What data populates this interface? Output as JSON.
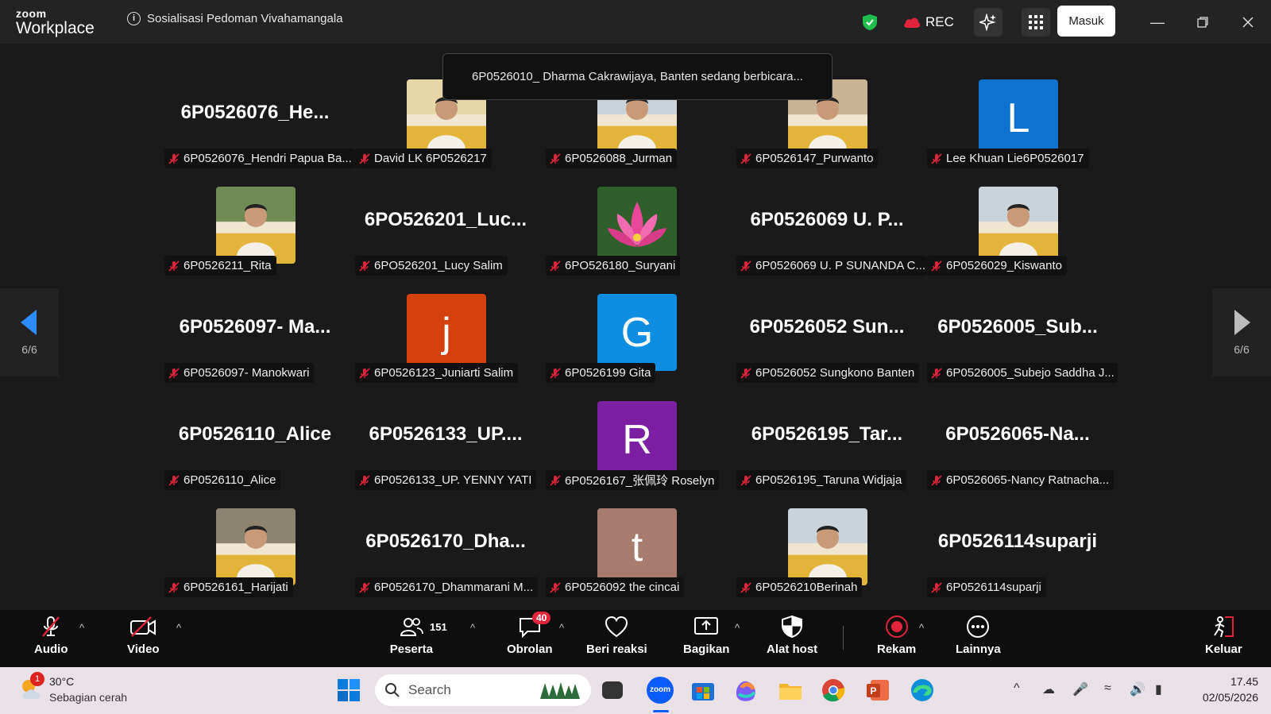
{
  "app": {
    "brand_small": "zoom",
    "brand_large": "Workplace",
    "meeting_title": "Sosialisasi Pedoman Vivahamangala"
  },
  "titlebar": {
    "rec_label": "REC",
    "signin_label": "Masuk"
  },
  "banner": "6P0526010_ Dharma Cakrawijaya, Banten sedang berbicara...",
  "pager": {
    "left_count": "6/6",
    "right_count": "6/6"
  },
  "tiles": [
    {
      "name": "6P0526076_Hendri Papua Ba...",
      "big": "6P0526076_He...",
      "avatar": ""
    },
    {
      "name": "David LK 6P0526217",
      "big": "",
      "avatar": "photo"
    },
    {
      "name": "6P0526088_Jurman",
      "big": "",
      "avatar": "photo"
    },
    {
      "name": "6P0526147_Purwanto",
      "big": "",
      "avatar": "photo"
    },
    {
      "name": "Lee Khuan Lie6P0526017",
      "big": "",
      "avatar": "L"
    },
    {
      "name": "6P0526211_Rita",
      "big": "",
      "avatar": "photo"
    },
    {
      "name": "6PO526201_Lucy Salim",
      "big": "6PO526201_Luc...",
      "avatar": ""
    },
    {
      "name": "6PO526180_Suryani",
      "big": "",
      "avatar": "lotus"
    },
    {
      "name": "6P0526069 U. P SUNANDA C...",
      "big": "6P0526069 U. P...",
      "avatar": ""
    },
    {
      "name": "6P0526029_Kiswanto",
      "big": "",
      "avatar": "photo"
    },
    {
      "name": "6P0526097- Manokwari",
      "big": "6P0526097- Ma...",
      "avatar": ""
    },
    {
      "name": "6P0526123_Juniarti Salim",
      "big": "",
      "avatar": "j"
    },
    {
      "name": "6P0526199 Gita",
      "big": "",
      "avatar": "G"
    },
    {
      "name": "6P0526052 Sungkono Banten",
      "big": "6P0526052 Sun...",
      "avatar": ""
    },
    {
      "name": "6P0526005_Subejo Saddha J...",
      "big": "6P0526005_Sub...",
      "avatar": ""
    },
    {
      "name": "6P0526110_Alice",
      "big": "6P0526110_Alice",
      "avatar": ""
    },
    {
      "name": "6P0526133_UP. YENNY YATI",
      "big": "6P0526133_UP....",
      "avatar": ""
    },
    {
      "name": "6P0526167_张佩玲 Roselyn",
      "big": "",
      "avatar": "R"
    },
    {
      "name": "6P0526195_Taruna Widjaja",
      "big": "6P0526195_Tar...",
      "avatar": ""
    },
    {
      "name": "6P0526065-Nancy Ratnacha...",
      "big": "6P0526065-Na...",
      "avatar": ""
    },
    {
      "name": "6P0526161_Harijati",
      "big": "",
      "avatar": "photo"
    },
    {
      "name": "6P0526170_Dhammarani M...",
      "big": "6P0526170_Dha...",
      "avatar": ""
    },
    {
      "name": "6P0526092 the cincai",
      "big": "",
      "avatar": "t"
    },
    {
      "name": "6P0526210Berinah",
      "big": "",
      "avatar": "photo"
    },
    {
      "name": "6P0526114suparji",
      "big": "6P0526114suparji",
      "avatar": ""
    }
  ],
  "toolbar": {
    "audio": "Audio",
    "video": "Video",
    "participants": "Peserta",
    "participant_count": "151",
    "chat": "Obrolan",
    "chat_badge": "40",
    "react": "Beri reaksi",
    "share": "Bagikan",
    "host_tools": "Alat host",
    "record": "Rekam",
    "more": "Lainnya",
    "leave": "Keluar"
  },
  "taskbar": {
    "weather_temp": "30°C",
    "weather_desc": "Sebagian cerah",
    "weather_badge": "1",
    "search_placeholder": "Search",
    "time": "17.45",
    "date": "02/05/2026"
  },
  "colors": {
    "accent_blue": "#0b5cff",
    "mute_red": "#e0243b"
  }
}
